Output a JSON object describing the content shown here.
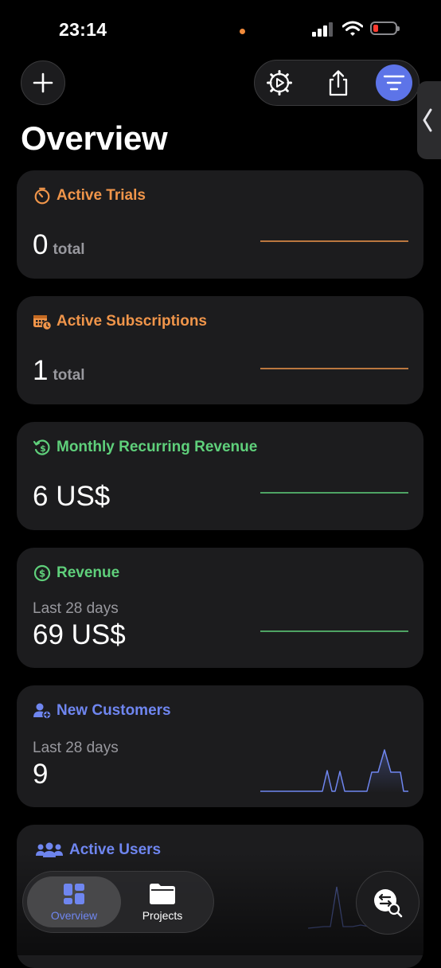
{
  "status": {
    "time": "23:14"
  },
  "page": {
    "title": "Overview"
  },
  "cards": [
    {
      "title": "Active Trials",
      "value": "0",
      "unit": "total",
      "color": "#f0954a",
      "icon": "timer-icon"
    },
    {
      "title": "Active Subscriptions",
      "value": "1",
      "unit": "total",
      "color": "#f0954a",
      "icon": "calendar-clock-icon"
    },
    {
      "title": "Monthly Recurring Revenue",
      "value": "6 US$",
      "color": "#5fd07b",
      "icon": "recurring-dollar-icon"
    },
    {
      "title": "Revenue",
      "subtitle": "Last 28 days",
      "value": "69 US$",
      "color": "#5fd07b",
      "icon": "dollar-circle-icon"
    },
    {
      "title": "New Customers",
      "subtitle": "Last 28 days",
      "value": "9",
      "color": "#6f86f0",
      "icon": "add-person-icon"
    },
    {
      "title": "Active Users",
      "color": "#6f86f0",
      "icon": "users-icon"
    }
  ],
  "tabs": [
    {
      "label": "Overview",
      "icon": "dashboard-icon",
      "selected": true
    },
    {
      "label": "Projects",
      "icon": "folder-icon",
      "selected": false
    }
  ],
  "actions": {
    "add": "plus-icon",
    "settings": "gear-play-icon",
    "share": "share-icon",
    "filter": "filter-lines-icon",
    "search": "transfer-search-icon"
  }
}
